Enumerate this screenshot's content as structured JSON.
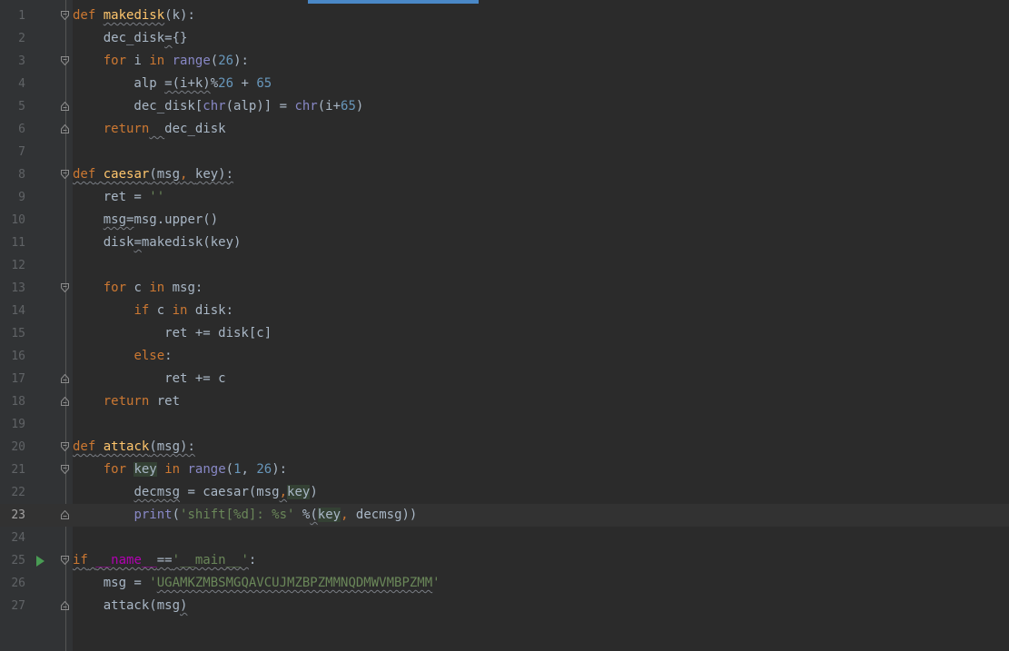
{
  "editor": {
    "language": "python",
    "current_line": 23,
    "lines": [
      {
        "n": "1",
        "fold": "open",
        "tokens": [
          {
            "t": "def",
            "c": "kw"
          },
          {
            "t": " "
          },
          {
            "t": "makedisk",
            "c": "fn",
            "s": true
          },
          {
            "t": "(k):"
          }
        ]
      },
      {
        "n": "2",
        "tokens": [
          {
            "t": "    dec_disk"
          },
          {
            "t": "=",
            "s": true
          },
          {
            "t": "{}"
          }
        ]
      },
      {
        "n": "3",
        "fold": "open",
        "tokens": [
          {
            "t": "    "
          },
          {
            "t": "for",
            "c": "kw"
          },
          {
            "t": " i "
          },
          {
            "t": "in",
            "c": "kw"
          },
          {
            "t": " "
          },
          {
            "t": "range",
            "c": "bi"
          },
          {
            "t": "("
          },
          {
            "t": "26",
            "c": "num"
          },
          {
            "t": "):"
          }
        ]
      },
      {
        "n": "4",
        "tokens": [
          {
            "t": "        alp "
          },
          {
            "t": "=(i+k)",
            "s": true
          },
          {
            "t": "%"
          },
          {
            "t": "26",
            "c": "num"
          },
          {
            "t": " + "
          },
          {
            "t": "65",
            "c": "num"
          }
        ]
      },
      {
        "n": "5",
        "fold": "close",
        "tokens": [
          {
            "t": "        dec_disk["
          },
          {
            "t": "chr",
            "c": "bi"
          },
          {
            "t": "(alp)] = "
          },
          {
            "t": "chr",
            "c": "bi"
          },
          {
            "t": "(i+"
          },
          {
            "t": "65",
            "c": "num"
          },
          {
            "t": ")"
          }
        ]
      },
      {
        "n": "6",
        "fold": "close",
        "tokens": [
          {
            "t": "    "
          },
          {
            "t": "return",
            "c": "kw"
          },
          {
            "t": "  ",
            "s": true
          },
          {
            "t": "dec_disk"
          }
        ]
      },
      {
        "n": "7",
        "tokens": []
      },
      {
        "n": "8",
        "fold": "open",
        "tokens": [
          {
            "t": "def",
            "c": "kw",
            "s": true
          },
          {
            "t": " ",
            "s": true
          },
          {
            "t": "caesar",
            "c": "fn",
            "s": true
          },
          {
            "t": "(msg",
            "s": true
          },
          {
            "t": ", ",
            "c": "kw",
            "s": true
          },
          {
            "t": "key):",
            "s": true
          }
        ]
      },
      {
        "n": "9",
        "tokens": [
          {
            "t": "    ret = "
          },
          {
            "t": "''",
            "c": "str"
          }
        ]
      },
      {
        "n": "10",
        "tokens": [
          {
            "t": "    "
          },
          {
            "t": "msg=",
            "s": true
          },
          {
            "t": "msg.upper()"
          }
        ]
      },
      {
        "n": "11",
        "tokens": [
          {
            "t": "    disk"
          },
          {
            "t": "=",
            "s": true
          },
          {
            "t": "makedisk(key)"
          }
        ]
      },
      {
        "n": "12",
        "tokens": []
      },
      {
        "n": "13",
        "fold": "open",
        "tokens": [
          {
            "t": "    "
          },
          {
            "t": "for",
            "c": "kw"
          },
          {
            "t": " c "
          },
          {
            "t": "in",
            "c": "kw"
          },
          {
            "t": " msg:"
          }
        ]
      },
      {
        "n": "14",
        "tokens": [
          {
            "t": "        "
          },
          {
            "t": "if",
            "c": "kw"
          },
          {
            "t": " c "
          },
          {
            "t": "in",
            "c": "kw"
          },
          {
            "t": " disk:"
          }
        ]
      },
      {
        "n": "15",
        "tokens": [
          {
            "t": "            ret += disk[c]"
          }
        ]
      },
      {
        "n": "16",
        "tokens": [
          {
            "t": "        "
          },
          {
            "t": "else",
            "c": "kw"
          },
          {
            "t": ":"
          }
        ]
      },
      {
        "n": "17",
        "fold": "close",
        "tokens": [
          {
            "t": "            ret += c"
          }
        ]
      },
      {
        "n": "18",
        "fold": "close",
        "tokens": [
          {
            "t": "    "
          },
          {
            "t": "return",
            "c": "kw"
          },
          {
            "t": " ret"
          }
        ]
      },
      {
        "n": "19",
        "tokens": []
      },
      {
        "n": "20",
        "fold": "open",
        "tokens": [
          {
            "t": "def",
            "c": "kw",
            "s": true
          },
          {
            "t": " ",
            "s": true
          },
          {
            "t": "attack",
            "c": "fn",
            "s": true
          },
          {
            "t": "(msg):",
            "s": true
          }
        ]
      },
      {
        "n": "21",
        "fold": "open",
        "tokens": [
          {
            "t": "    "
          },
          {
            "t": "for",
            "c": "kw"
          },
          {
            "t": " "
          },
          {
            "t": "key",
            "h": true
          },
          {
            "t": " "
          },
          {
            "t": "in",
            "c": "kw"
          },
          {
            "t": " "
          },
          {
            "t": "range",
            "c": "bi"
          },
          {
            "t": "("
          },
          {
            "t": "1",
            "c": "num"
          },
          {
            "t": ", "
          },
          {
            "t": "26",
            "c": "num"
          },
          {
            "t": "):"
          }
        ]
      },
      {
        "n": "22",
        "tokens": [
          {
            "t": "        "
          },
          {
            "t": "decmsg",
            "s": true
          },
          {
            "t": " = caesar(msg"
          },
          {
            "t": ",",
            "c": "kw",
            "s": true
          },
          {
            "t": "key",
            "h": true
          },
          {
            "t": ")"
          }
        ]
      },
      {
        "n": "23",
        "fold": "close",
        "tokens": [
          {
            "t": "        "
          },
          {
            "t": "print",
            "c": "bi"
          },
          {
            "t": "("
          },
          {
            "t": "'shift[%d]: %s'",
            "c": "str"
          },
          {
            "t": " %"
          },
          {
            "t": "(",
            "s": true
          },
          {
            "t": "k",
            "h": true
          },
          {
            "caret": true
          },
          {
            "t": "ey",
            "h": true
          },
          {
            "t": ", ",
            "c": "kw"
          },
          {
            "t": "decmsg))"
          }
        ]
      },
      {
        "n": "24",
        "tokens": []
      },
      {
        "n": "25",
        "fold": "open",
        "run": true,
        "tokens": [
          {
            "t": "if",
            "c": "kw",
            "s": true
          },
          {
            "t": " ",
            "s": true
          },
          {
            "t": "__name__",
            "c": "dunder",
            "s": true
          },
          {
            "t": "==",
            "s": true
          },
          {
            "t": "'__main__'",
            "c": "str",
            "s": true
          },
          {
            "t": ":"
          }
        ]
      },
      {
        "n": "26",
        "tokens": [
          {
            "t": "    msg = "
          },
          {
            "t": "'",
            "c": "str"
          },
          {
            "t": "UGAMKZMBSMGQAVCUJMZBPZMMNQDMWVMBPZMM",
            "c": "str",
            "s": true
          },
          {
            "t": "'",
            "c": "str"
          }
        ]
      },
      {
        "n": "27",
        "fold": "close",
        "tokens": [
          {
            "t": "    attack(msg"
          },
          {
            "t": ")",
            "s": true
          }
        ]
      }
    ]
  }
}
